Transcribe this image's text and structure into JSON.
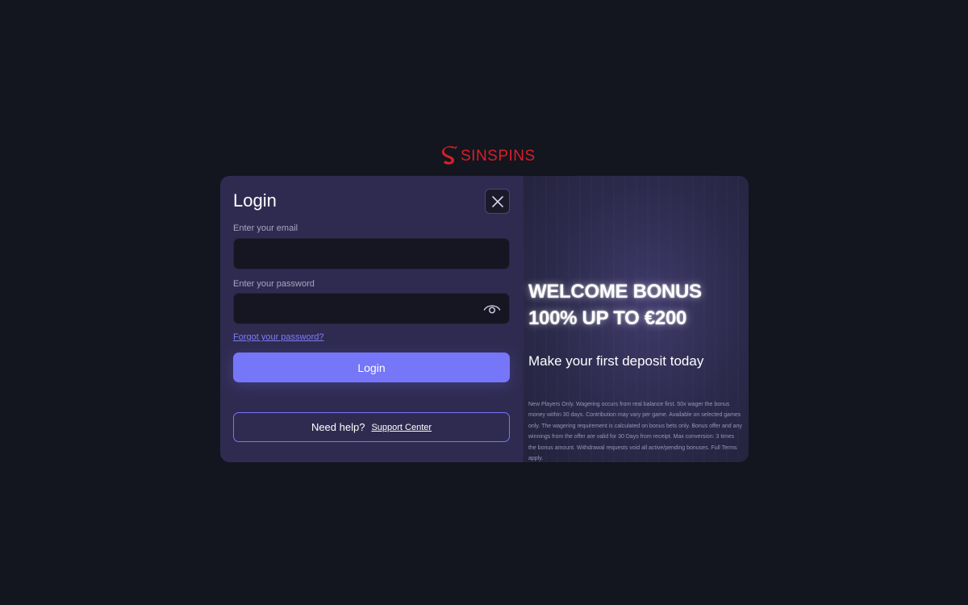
{
  "brand": {
    "name": "SINSPINS",
    "logo_icon": "serpent-s-logo-icon",
    "color": "#d91f26"
  },
  "login": {
    "title": "Login",
    "close_icon": "close-icon",
    "email_label": "Enter your email",
    "email_value": "",
    "password_label": "Enter your password",
    "password_value": "",
    "password_toggle_icon": "eye-icon",
    "forgot_link": "Forgot your password?",
    "submit_label": "Login",
    "help_text": "Need help?",
    "support_link": "Support Center"
  },
  "promo": {
    "headline_line1": "WELCOME BONUS",
    "headline_line2": "100% UP TO €200",
    "subheadline": "Make your first deposit today",
    "terms": "New Players Only. Wagering occurs from real balance first. 50x wager the bonus money within 30 days. Contribution may vary per game. Available on selected games only. The wagering requirement is calculated on bonus bets only. Bonus offer and any winnings from the offer are valid for 30 Days from receipt. Max conversion: 3 times the bonus amount. Withdrawal requests void all active/pending bonuses. Full Terms apply."
  },
  "colors": {
    "page_background": "#13151f",
    "modal_background": "#2f2b50",
    "input_background": "#161622",
    "accent": "#7576f8",
    "link": "#7f7cf6"
  }
}
